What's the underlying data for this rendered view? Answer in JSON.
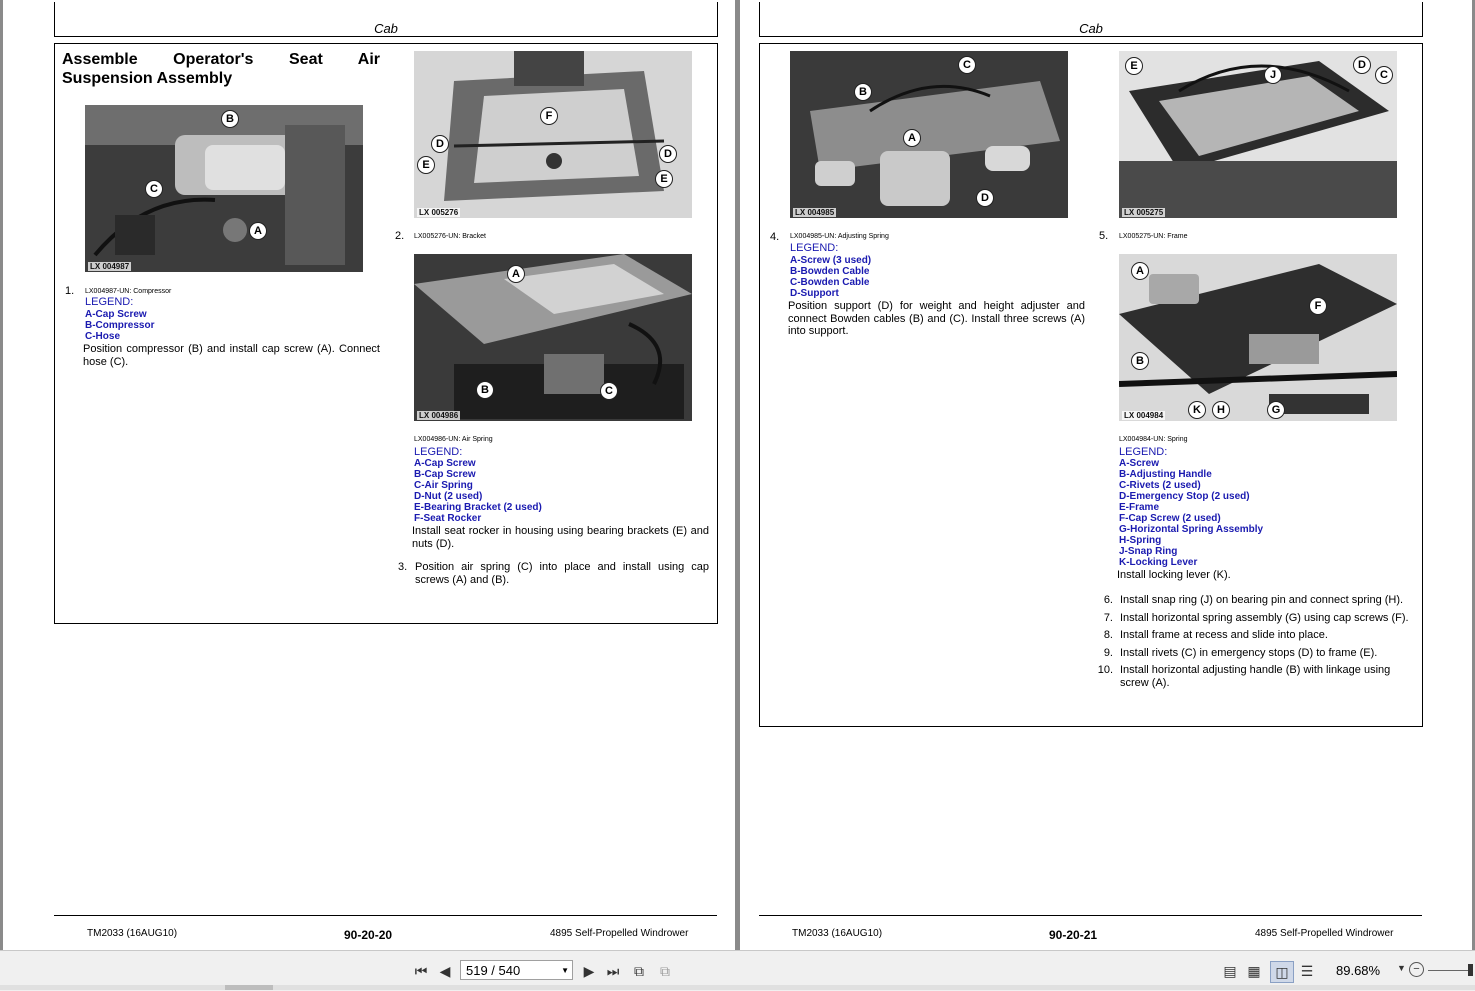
{
  "left_page": {
    "header": "Cab",
    "title": "Assemble Operator's Seat Air Suspension Assembly",
    "figures": [
      {
        "code": "LX 004987",
        "callouts": [
          "B",
          "C",
          "A"
        ]
      },
      {
        "code": "LX 005276",
        "callouts": [
          "F",
          "D",
          "D",
          "E",
          "E"
        ]
      },
      {
        "code": "LX 004986",
        "callouts": [
          "A",
          "B",
          "C"
        ]
      }
    ],
    "step1": {
      "num": "1.",
      "caption": "LX004987-UN: Compressor",
      "legend_title": "LEGEND:",
      "legend": [
        "A-Cap Screw",
        "B-Compressor",
        "C-Hose"
      ],
      "text": "Position compressor (B) and install cap screw (A). Connect hose (C)."
    },
    "step2": {
      "num": "2.",
      "caption": "LX005276-UN: Bracket",
      "caption2": "LX004986-UN: Air Spring",
      "legend_title": "LEGEND:",
      "legend": [
        "A-Cap Screw",
        "B-Cap Screw",
        "C-Air Spring",
        "D-Nut (2 used)",
        "E-Bearing Bracket (2 used)",
        "F-Seat Rocker"
      ],
      "text": "Install seat rocker in housing using bearing brackets (E) and nuts (D)."
    },
    "step3": {
      "num": "3.",
      "text": "Position air spring (C) into place and install using cap screws (A) and (B)."
    },
    "footer": {
      "left": "TM2033 (16AUG10)",
      "center": "90-20-20",
      "right": "4895 Self-Propelled Windrower"
    }
  },
  "right_page": {
    "header": "Cab",
    "figures": [
      {
        "code": "LX 004985",
        "callouts": [
          "C",
          "B",
          "A",
          "D"
        ]
      },
      {
        "code": "LX 005275",
        "callouts": [
          "E",
          "J",
          "D",
          "C"
        ]
      },
      {
        "code": "LX 004984",
        "callouts": [
          "A",
          "F",
          "B",
          "K",
          "H",
          "G"
        ]
      }
    ],
    "step4": {
      "num": "4.",
      "caption": "LX004985-UN: Adjusting Spring",
      "legend_title": "LEGEND:",
      "legend": [
        "A-Screw (3 used)",
        "B-Bowden Cable",
        "C-Bowden Cable",
        "D-Support"
      ],
      "text": "Position support (D) for weight and height adjuster and connect Bowden cables (B) and (C). Install three screws (A) into support."
    },
    "step5": {
      "num": "5.",
      "caption": "LX005275-UN: Frame",
      "caption2": "LX004984-UN: Spring",
      "legend_title": "LEGEND:",
      "legend": [
        "A-Screw",
        "B-Adjusting Handle",
        "C-Rivets (2 used)",
        "D-Emergency Stop (2 used)",
        "E-Frame",
        "F-Cap Screw (2 used)",
        "G-Horizontal Spring Assembly",
        "H-Spring",
        "J-Snap Ring",
        "K-Locking Lever"
      ],
      "text": "Install locking lever (K)."
    },
    "steps": [
      {
        "num": "6.",
        "text": "Install snap ring (J) on bearing pin and connect spring (H)."
      },
      {
        "num": "7.",
        "text": "Install horizontal spring assembly (G) using cap screws (F)."
      },
      {
        "num": "8.",
        "text": "Install frame at recess and slide into place."
      },
      {
        "num": "9.",
        "text": "Install rivets (C) in emergency stops (D) to frame (E)."
      },
      {
        "num": "10.",
        "text": "Install horizontal adjusting handle (B) with linkage using screw (A)."
      }
    ],
    "footer": {
      "left": "TM2033 (16AUG10)",
      "center": "90-20-21",
      "right": "4895 Self-Propelled Windrower"
    }
  },
  "toolbar": {
    "first_icon": "first-page-icon",
    "prev_icon": "previous-page-icon",
    "page_value": "519 / 540",
    "next_icon": "next-page-icon",
    "last_icon": "last-page-icon",
    "zoom": "89.68%"
  }
}
